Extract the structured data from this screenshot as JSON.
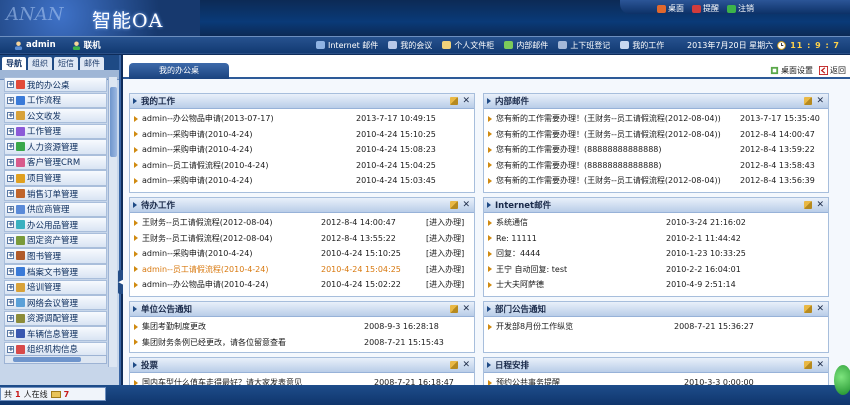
{
  "brand": {
    "deco": "ANAN",
    "name": "智能OA"
  },
  "top_links": [
    {
      "label": "桌面",
      "icon": "desktop-icon",
      "color": "#e0682d"
    },
    {
      "label": "提醒",
      "icon": "reminder-icon",
      "color": "#d23c3c"
    },
    {
      "label": "注销",
      "icon": "logout-icon",
      "color": "#3cb34a"
    }
  ],
  "user": {
    "name": "admin",
    "status": "联机"
  },
  "nav": [
    {
      "label": "Internet 邮件",
      "icon": "internet-mail-icon"
    },
    {
      "label": "我的会议",
      "icon": "meeting-icon"
    },
    {
      "label": "个人文件柜",
      "icon": "file-cabinet-icon"
    },
    {
      "label": "内部邮件",
      "icon": "internal-mail-icon"
    },
    {
      "label": "上下班登记",
      "icon": "attendance-icon"
    },
    {
      "label": "我的工作",
      "icon": "my-work-icon"
    }
  ],
  "datetime": {
    "date": "2013年7月20日 星期六",
    "clock": "11 : 9 : 7"
  },
  "sidebar": {
    "tabs": [
      "导航",
      "组织",
      "短信",
      "邮件"
    ],
    "items": [
      {
        "label": "我的办公桌",
        "color": "#e24a3a"
      },
      {
        "label": "工作流程",
        "color": "#3a7ad8"
      },
      {
        "label": "公文收发",
        "color": "#d8a23a"
      },
      {
        "label": "工作管理",
        "color": "#8c5ad8"
      },
      {
        "label": "人力资源管理",
        "color": "#3aa84a"
      },
      {
        "label": "客户管理CRM",
        "color": "#d85a8c"
      },
      {
        "label": "项目管理",
        "color": "#e0a020"
      },
      {
        "label": "销售订单管理",
        "color": "#c0642a"
      },
      {
        "label": "供应商管理",
        "color": "#5a8ad8"
      },
      {
        "label": "办公用品管理",
        "color": "#3ab0c0"
      },
      {
        "label": "固定资产管理",
        "color": "#7a9a3a"
      },
      {
        "label": "图书管理",
        "color": "#b05a2a"
      },
      {
        "label": "档案文书管理",
        "color": "#3a7ad8"
      },
      {
        "label": "培训管理",
        "color": "#d8a23a"
      },
      {
        "label": "网络会议管理",
        "color": "#5aa0d8"
      },
      {
        "label": "资源调配管理",
        "color": "#8c8c3a"
      },
      {
        "label": "车辆信息管理",
        "color": "#3a58b0"
      },
      {
        "label": "组织机构信息",
        "color": "#d84a4a"
      }
    ]
  },
  "main": {
    "tab": "我的办公桌",
    "desktop_settings": "桌面设置",
    "back": "返回",
    "portals": {
      "my_work": {
        "title": "我的工作",
        "rows": [
          {
            "text": "admin--办公物品申请(2013-07-17)",
            "date": "2013-7-17 10:49:15"
          },
          {
            "text": "admin--采购申请(2010-4-24)",
            "date": "2010-4-24 15:10:25"
          },
          {
            "text": "admin--采购申请(2010-4-24)",
            "date": "2010-4-24 15:08:23"
          },
          {
            "text": "admin--员工请假流程(2010-4-24)",
            "date": "2010-4-24 15:04:25"
          },
          {
            "text": "admin--采购申请(2010-4-24)",
            "date": "2010-4-24 15:03:45"
          }
        ]
      },
      "internal_mail": {
        "title": "内部邮件",
        "rows": [
          {
            "text": "您有新的工作需要办理！(王财务--员工请假流程(2012-08-04))",
            "date": "2013-7-17 15:35:40"
          },
          {
            "text": "您有新的工作需要办理！(王财务--员工请假流程(2012-08-04))",
            "date": "2012-8-4 14:00:47"
          },
          {
            "text": "您有新的工作需要办理！(88888888888888)",
            "date": "2012-8-4 13:59:22"
          },
          {
            "text": "您有新的工作需要办理！(88888888888888)",
            "date": "2012-8-4 13:58:43"
          },
          {
            "text": "您有新的工作需要办理！(王财务--员工请假流程(2012-08-04))",
            "date": "2012-8-4 13:56:39"
          }
        ]
      },
      "todo": {
        "title": "待办工作",
        "rows": [
          {
            "text": "王财务--员工请假流程(2012-08-04)",
            "date": "2012-8-4 14:00:47",
            "action": "[进入办理]",
            "orange": false
          },
          {
            "text": "王财务--员工请假流程(2012-08-04)",
            "date": "2012-8-4 13:55:22",
            "action": "[进入办理]",
            "orange": false
          },
          {
            "text": "admin--采购申请(2010-4-24)",
            "date": "2010-4-24 15:10:25",
            "action": "[进入办理]",
            "orange": false
          },
          {
            "text": "admin--员工请假流程(2010-4-24)",
            "date": "2010-4-24 15:04:25",
            "action": "[进入办理]",
            "orange": true
          },
          {
            "text": "admin--办公物品申请(2010-4-24)",
            "date": "2010-4-24 15:02:22",
            "action": "[进入办理]",
            "orange": false
          }
        ]
      },
      "internet_mail": {
        "title": "Internet邮件",
        "rows": [
          {
            "text": "系统通信",
            "date": "2010-3-24 21:16:02"
          },
          {
            "text": "Re: 11111",
            "date": "2010-2-1 11:44:42"
          },
          {
            "text": "回复：4444",
            "date": "2010-1-23 10:33:25"
          },
          {
            "text": "王宁 自动回复: test",
            "date": "2010-2-2 16:04:01"
          },
          {
            "text": "士大夫阿萨德",
            "date": "2010-4-9 2:51:14"
          }
        ]
      },
      "unit_notice": {
        "title": "单位公告通知",
        "rows": [
          {
            "text": "集团考勤制度更改",
            "date": "2008-9-3 16:28:18"
          },
          {
            "text": "集团财务条例已经更改，请各位留意查看",
            "date": "2008-7-21 15:15:43"
          }
        ]
      },
      "dept_notice": {
        "title": "部门公告通知",
        "rows": [
          {
            "text": "开发部8月份工作纵览",
            "date": "2008-7-21 15:36:27"
          }
        ]
      },
      "vote": {
        "title": "投票",
        "rows": [
          {
            "text": "国内车型什么值车走得最好？请大家发表意见",
            "date": "2008-7-21 16:18:47"
          }
        ]
      },
      "schedule": {
        "title": "日程安排",
        "rows": [
          {
            "text": "预约公共事务提醒",
            "date": "2010-3-3 0:00:00"
          }
        ]
      }
    }
  },
  "status": {
    "prefix": "共",
    "online_count": "1",
    "online_suffix": "人在线",
    "mail_count": "7"
  },
  "colors": {
    "nav_blue": "#123a72",
    "accent_orange": "#d8780e",
    "link_red": "#c02020"
  }
}
